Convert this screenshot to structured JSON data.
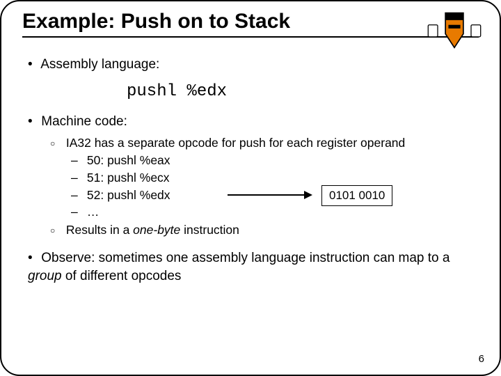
{
  "title": "Example: Push on to Stack",
  "bullets": {
    "assembly_label": "Assembly language:",
    "code": "pushl %edx",
    "machine_label": "Machine code:",
    "ia32": "IA32 has a separate opcode for push for each register operand",
    "op50": "50: pushl %eax",
    "op51": "51: pushl %ecx",
    "op52": "52: pushl %edx",
    "opell": "…",
    "bits": "0101 0010",
    "result_pre": "Results in a ",
    "result_em": "one-byte",
    "result_post": " instruction",
    "observe_pre": "Observe: sometimes one assembly language instruction can map to a ",
    "observe_em": "group",
    "observe_post": " of different opcodes"
  },
  "page_number": "6",
  "logo": {
    "name": "princeton-shield"
  }
}
